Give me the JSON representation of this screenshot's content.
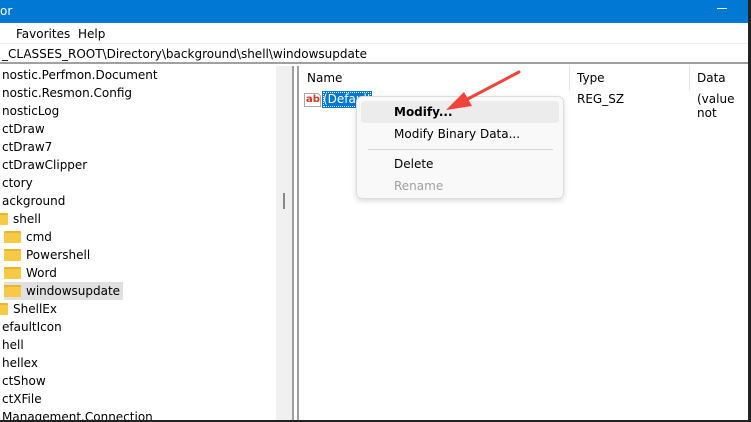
{
  "window": {
    "title": "or"
  },
  "menu": [
    "Favorites",
    "Help"
  ],
  "address": "_CLASSES_ROOT\\Directory\\background\\shell\\windowsupdate",
  "tree": [
    {
      "label": "nostic.Perfmon.Document",
      "indent": 0,
      "folder": false
    },
    {
      "label": "nostic.Resmon.Config",
      "indent": 0,
      "folder": false
    },
    {
      "label": "nosticLog",
      "indent": 0,
      "folder": false
    },
    {
      "label": "ctDraw",
      "indent": 0,
      "folder": false
    },
    {
      "label": "ctDraw7",
      "indent": 0,
      "folder": false
    },
    {
      "label": "ctDrawClipper",
      "indent": 0,
      "folder": false
    },
    {
      "label": "ctory",
      "indent": 0,
      "folder": false
    },
    {
      "label": "ackground",
      "indent": 0,
      "folder": false
    },
    {
      "label": "shell",
      "indent": 1,
      "folder": true
    },
    {
      "label": "cmd",
      "indent": 2,
      "folder": true
    },
    {
      "label": "Powershell",
      "indent": 2,
      "folder": true
    },
    {
      "label": "Word",
      "indent": 2,
      "folder": true
    },
    {
      "label": "windowsupdate",
      "indent": 2,
      "folder": true,
      "selected": true
    },
    {
      "label": "ShellEx",
      "indent": 1,
      "folder": true
    },
    {
      "label": "efaultIcon",
      "indent": 0,
      "folder": false
    },
    {
      "label": "hell",
      "indent": 0,
      "folder": false
    },
    {
      "label": "hellex",
      "indent": 0,
      "folder": false
    },
    {
      "label": "ctShow",
      "indent": 0,
      "folder": false
    },
    {
      "label": "ctXFile",
      "indent": 0,
      "folder": false
    },
    {
      "label": "Management.Connection",
      "indent": 0,
      "folder": false
    }
  ],
  "columns": {
    "name": "Name",
    "type": "Type",
    "data": "Data"
  },
  "value_row": {
    "name": "(Default)",
    "type": "REG_SZ",
    "data": "(value not",
    "icon": "ab"
  },
  "context_menu": {
    "modify": "Modify...",
    "modify_binary": "Modify Binary Data...",
    "delete": "Delete",
    "rename": "Rename"
  }
}
